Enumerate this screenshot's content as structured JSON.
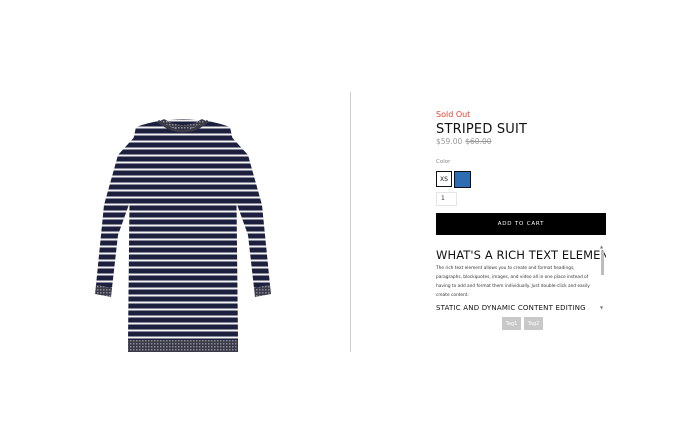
{
  "product": {
    "status": "Sold Out",
    "name": "STRIPED SUIT",
    "price": "$59.00",
    "compare_price": "$60.00",
    "image_icon": "striped-sweater-dress-image"
  },
  "options": {
    "color_label": "Color",
    "size_selected": "XS",
    "swatch_color": "#2f6db2",
    "quantity": "1"
  },
  "cart": {
    "add_label": "ADD TO CART"
  },
  "description": {
    "heading": "WHAT'S A RICH TEXT ELEMENT?",
    "paragraph": "The rich text element allows you to create and format headings, paragraphs, blockquotes, images, and video all in one place instead of having to add and format them individually. Just double-click and easily create content.",
    "subheading": "STATIC AND DYNAMIC CONTENT EDITING"
  },
  "tags": [
    "Tag1",
    "Tag2"
  ],
  "colors": {
    "sold_out": "#e2402f",
    "button_bg": "#000000",
    "tag_bg": "#c8c8c8"
  }
}
